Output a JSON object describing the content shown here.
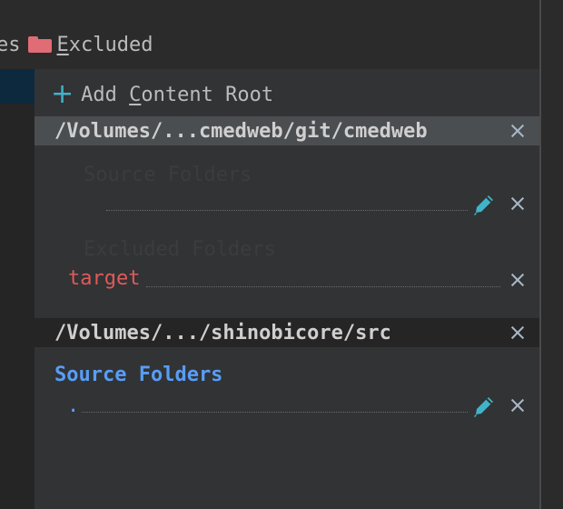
{
  "toolbar": {
    "prev_label_fragment": "es",
    "excluded_prefix": "E",
    "excluded_rest": "xcluded"
  },
  "add_root": {
    "prefix": "Add ",
    "mnemonic": "C",
    "rest": "ontent Root"
  },
  "roots": [
    {
      "path": "/Volumes/...cmedweb/git/cmedweb",
      "sections": [
        {
          "title": "Source Folders",
          "folders": [
            ""
          ],
          "faded": true
        },
        {
          "title": "Excluded Folders",
          "folders": [
            "target"
          ],
          "faded": true
        }
      ]
    },
    {
      "path": "/Volumes/.../shinobicore/src",
      "sections": [
        {
          "title": "Source Folders",
          "folders": [
            "."
          ]
        }
      ]
    }
  ],
  "colors": {
    "accent": "#3fb4c9",
    "excluded_folder": "#e05a5a",
    "source_folder": "#5aa0ff",
    "excluded_icon": "#e06c75"
  },
  "icons": [
    "folder-icon",
    "plus-icon",
    "close-icon",
    "pencil-icon"
  ]
}
